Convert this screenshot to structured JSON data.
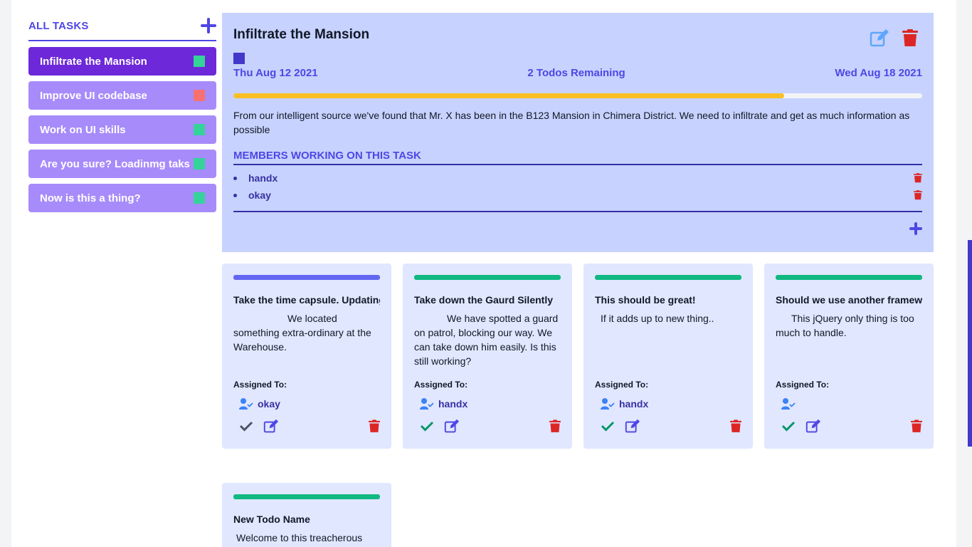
{
  "sidebar": {
    "title": "ALL TASKS",
    "items": [
      {
        "label": "Infiltrate the Mansion",
        "color": "#34d399",
        "active": true
      },
      {
        "label": "Improve UI codebase",
        "color": "#f87171",
        "active": false
      },
      {
        "label": "Work on UI skills",
        "color": "#34d399",
        "active": false
      },
      {
        "label": "Are you sure? Loadinmg taks",
        "color": "#34d399",
        "active": false
      },
      {
        "label": "Now is this a thing?",
        "color": "#34d399",
        "active": false
      }
    ]
  },
  "detail": {
    "title": "Infiltrate the Mansion",
    "color": "#4338ca",
    "start_date": "Thu Aug 12 2021",
    "remaining": "2 Todos Remaining",
    "end_date": "Wed Aug 18 2021",
    "progress": 0.8,
    "description": "From our intelligent source we've found that Mr. X has been in the B123 Mansion in Chimera District. We need to infiltrate and get as much information as possible",
    "members_title": "MEMBERS WORKING ON THIS TASK",
    "members": [
      "handx",
      "okay"
    ]
  },
  "todos": [
    {
      "title": "Take the time capsule. Updating",
      "description": "We located something extra-ordinary at the Warehouse.",
      "assigned_label": "Assigned To:",
      "assignee": "okay",
      "bar_color": "#6366f1",
      "done": false
    },
    {
      "title": "Take down the Gaurd Silently",
      "description": "We have spotted a guard on patrol, blocking our way. We can take down him easily. Is this still working?",
      "assigned_label": "Assigned To:",
      "assignee": "handx",
      "bar_color": "#10b981",
      "done": true
    },
    {
      "title": "This should be great!",
      "description": "If it adds up to new thing..",
      "assigned_label": "Assigned To:",
      "assignee": "handx",
      "bar_color": "#10b981",
      "done": true
    },
    {
      "title": "Should we use another framework",
      "description": "This jQuery only thing is too much to handle.",
      "assigned_label": "Assigned To:",
      "assignee": "",
      "bar_color": "#10b981",
      "done": true
    },
    {
      "title": "New Todo Name",
      "description": "Welcome to this treacherous",
      "assigned_label": "",
      "assignee": "",
      "bar_color": "#10b981",
      "done": true
    }
  ]
}
